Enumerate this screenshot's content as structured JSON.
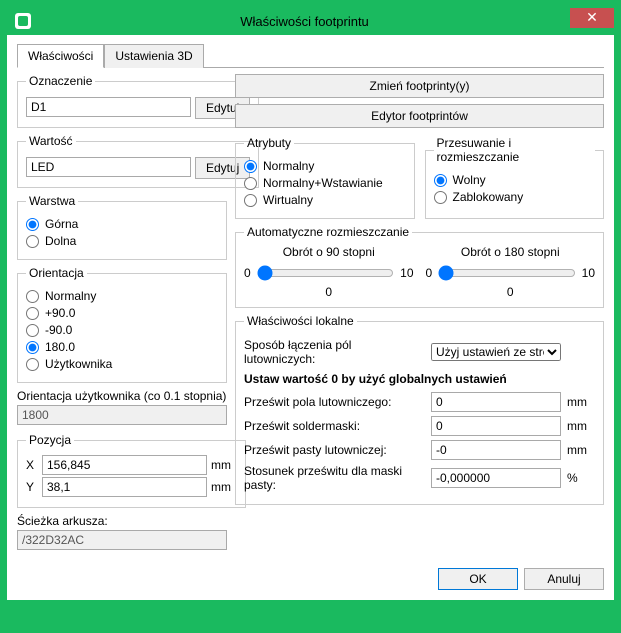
{
  "window_title": "Właściwości footprintu",
  "close_glyph": "✕",
  "tabs": {
    "properties": "Właściwości",
    "settings3d": "Ustawienia 3D"
  },
  "designator": {
    "legend": "Oznaczenie",
    "value": "D1",
    "edit": "Edytuj"
  },
  "value": {
    "legend": "Wartość",
    "value": "LED",
    "edit": "Edytuj"
  },
  "layer": {
    "legend": "Warstwa",
    "top": "Górna",
    "bottom": "Dolna"
  },
  "orientation": {
    "legend": "Orientacja",
    "normal": "Normalny",
    "p90": "+90.0",
    "m90": "-90.0",
    "r180": "180.0",
    "user": "Użytkownika"
  },
  "user_orient": {
    "label": "Orientacja użytkownika (co 0.1 stopnia)",
    "value": "1800"
  },
  "position": {
    "legend": "Pozycja",
    "x_label": "X",
    "x": "156,845",
    "y_label": "Y",
    "y": "38,1",
    "unit": "mm"
  },
  "sheet": {
    "label": "Ścieżka arkusza:",
    "value": "/322D32AC"
  },
  "buttons": {
    "change_fp": "Zmień footprinty(y)",
    "fp_editor": "Edytor footprintów"
  },
  "attributes": {
    "legend": "Atrybuty",
    "normal": "Normalny",
    "normal_insert": "Normalny+Wstawianie",
    "virtual": "Wirtualny"
  },
  "placement": {
    "legend": "Przesuwanie i rozmieszczanie",
    "free": "Wolny",
    "locked": "Zablokowany"
  },
  "auto": {
    "legend": "Automatyczne rozmieszczanie",
    "rot90": "Obrót o 90 stopni",
    "rot180": "Obrót o 180 stopni",
    "min": "0",
    "max": "10",
    "val": "0"
  },
  "local": {
    "legend": "Właściwości lokalne",
    "pad_connect": "Sposób łączenia pól lutowniczych:",
    "pad_connect_value": "Użyj ustawień ze stref",
    "note": "Ustaw wartość 0 by użyć globalnych ustawień",
    "clearance": "Prześwit pola lutowniczego:",
    "clearance_v": "0",
    "soldermask": "Prześwit soldermaski:",
    "soldermask_v": "0",
    "solderpaste": "Prześwit pasty lutowniczej:",
    "solderpaste_v": "-0",
    "paste_ratio": "Stosunek prześwitu dla maski pasty:",
    "paste_ratio_v": "-0,000000",
    "unit_mm": "mm",
    "unit_pct": "%"
  },
  "footer": {
    "ok": "OK",
    "cancel": "Anuluj"
  }
}
